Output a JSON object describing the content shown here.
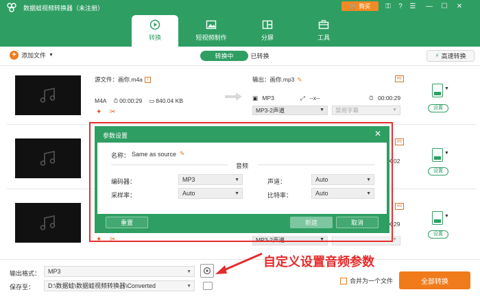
{
  "app": {
    "title": "数据蛙视频转换器（未注册）",
    "buy_label": "购买"
  },
  "nav": {
    "tabs": [
      {
        "label": "转换"
      },
      {
        "label": "短视频制作"
      },
      {
        "label": "分屏"
      },
      {
        "label": "工具"
      }
    ]
  },
  "toolbar": {
    "add_file": "添加文件",
    "converting": "转换中",
    "converted": "已转换",
    "fast_convert": "高速转换"
  },
  "rows": [
    {
      "source_label": "源文件：画你.m4a",
      "format": "M4A",
      "duration": "00:00:29",
      "size": "840.04 KB",
      "output_label": "输出：画你.mp3",
      "out_format": "MP3",
      "out_res": "--x--",
      "out_duration": "00:00:29",
      "channel": "MP3-2声道",
      "subtitle": "禁用字幕",
      "settings": "设置"
    },
    {
      "out_duration": "X:02",
      "settings": "设置"
    },
    {
      "out_duration": "X:29",
      "settings": "设置",
      "channel_partial": "MP3-2声道"
    }
  ],
  "bottom": {
    "output_format_label": "输出格式：",
    "output_format_value": "MP3",
    "save_to_label": "保存至：",
    "save_to_value": "D:\\数据蛙\\数据蛙视频转换器\\Converted",
    "merge_label": "合并为一个文件",
    "convert_all": "全部转换"
  },
  "dialog": {
    "title": "参数设置",
    "name_label": "名称：",
    "name_value": "Same as source",
    "section_audio": "音频",
    "encoder_label": "编码器：",
    "encoder_value": "MP3",
    "channel_label": "声道：",
    "channel_value": "Auto",
    "samplerate_label": "采样率：",
    "samplerate_value": "Auto",
    "bitrate_label": "比特率：",
    "bitrate_value": "Auto",
    "reset": "重置",
    "new": "新建",
    "cancel": "取消"
  },
  "annotation": {
    "text": "自定义设置音频参数"
  },
  "colors": {
    "brand_green": "#2f9e63",
    "accent_orange": "#f07b1b",
    "annotation_red": "#e62b2b"
  }
}
